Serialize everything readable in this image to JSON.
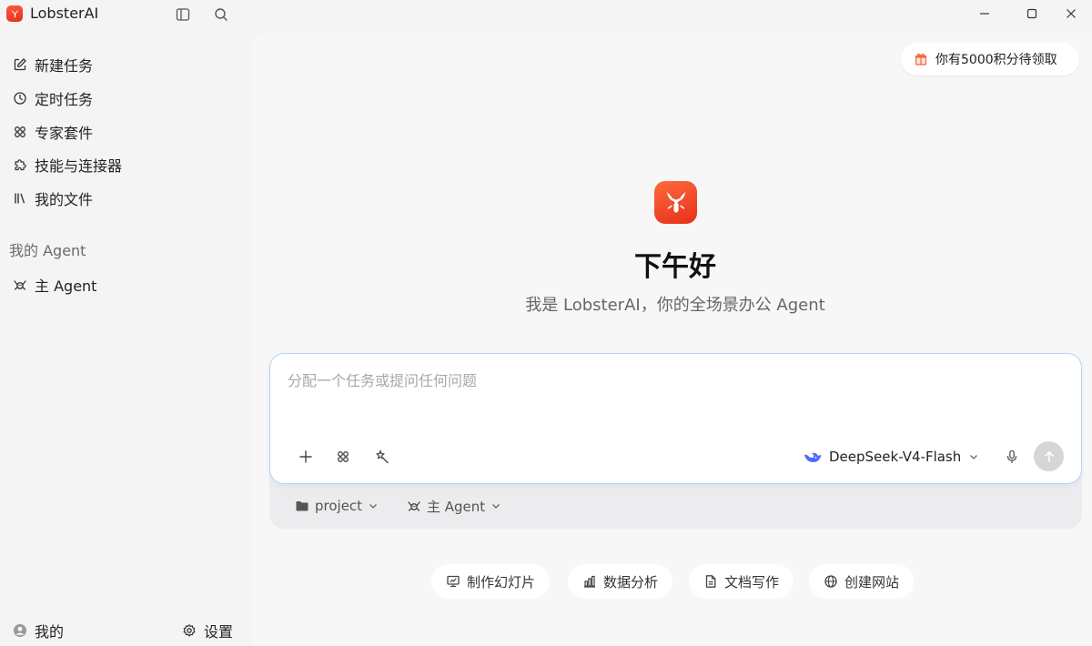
{
  "app": {
    "name": "LobsterAI"
  },
  "sidebar": {
    "items": [
      {
        "label": "新建任务",
        "icon": "edit-icon"
      },
      {
        "label": "定时任务",
        "icon": "clock-icon"
      },
      {
        "label": "专家套件",
        "icon": "grid-icon"
      },
      {
        "label": "技能与连接器",
        "icon": "puzzle-icon"
      },
      {
        "label": "我的文件",
        "icon": "library-icon"
      }
    ],
    "section_label": "我的 Agent",
    "agents": [
      {
        "label": "主 Agent",
        "icon": "agent-icon"
      }
    ],
    "footer": {
      "profile_label": "我的",
      "settings_label": "设置"
    }
  },
  "main": {
    "points_badge": "你有5000积分待领取",
    "greeting": "下午好",
    "subtitle": "我是 LobsterAI，你的全场景办公 Agent",
    "composer": {
      "placeholder": "分配一个任务或提问任何问题",
      "model": "DeepSeek-V4-Flash",
      "project": "project",
      "agent": "主 Agent"
    },
    "quick_actions": [
      {
        "label": "制作幻灯片",
        "icon": "presentation-icon"
      },
      {
        "label": "数据分析",
        "icon": "bar-chart-icon"
      },
      {
        "label": "文档写作",
        "icon": "document-icon"
      },
      {
        "label": "创建网站",
        "icon": "globe-icon"
      }
    ]
  },
  "colors": {
    "brand": "#e5301a",
    "composer_border": "#b9d3f0",
    "model_icon": "#4d6bfe"
  }
}
